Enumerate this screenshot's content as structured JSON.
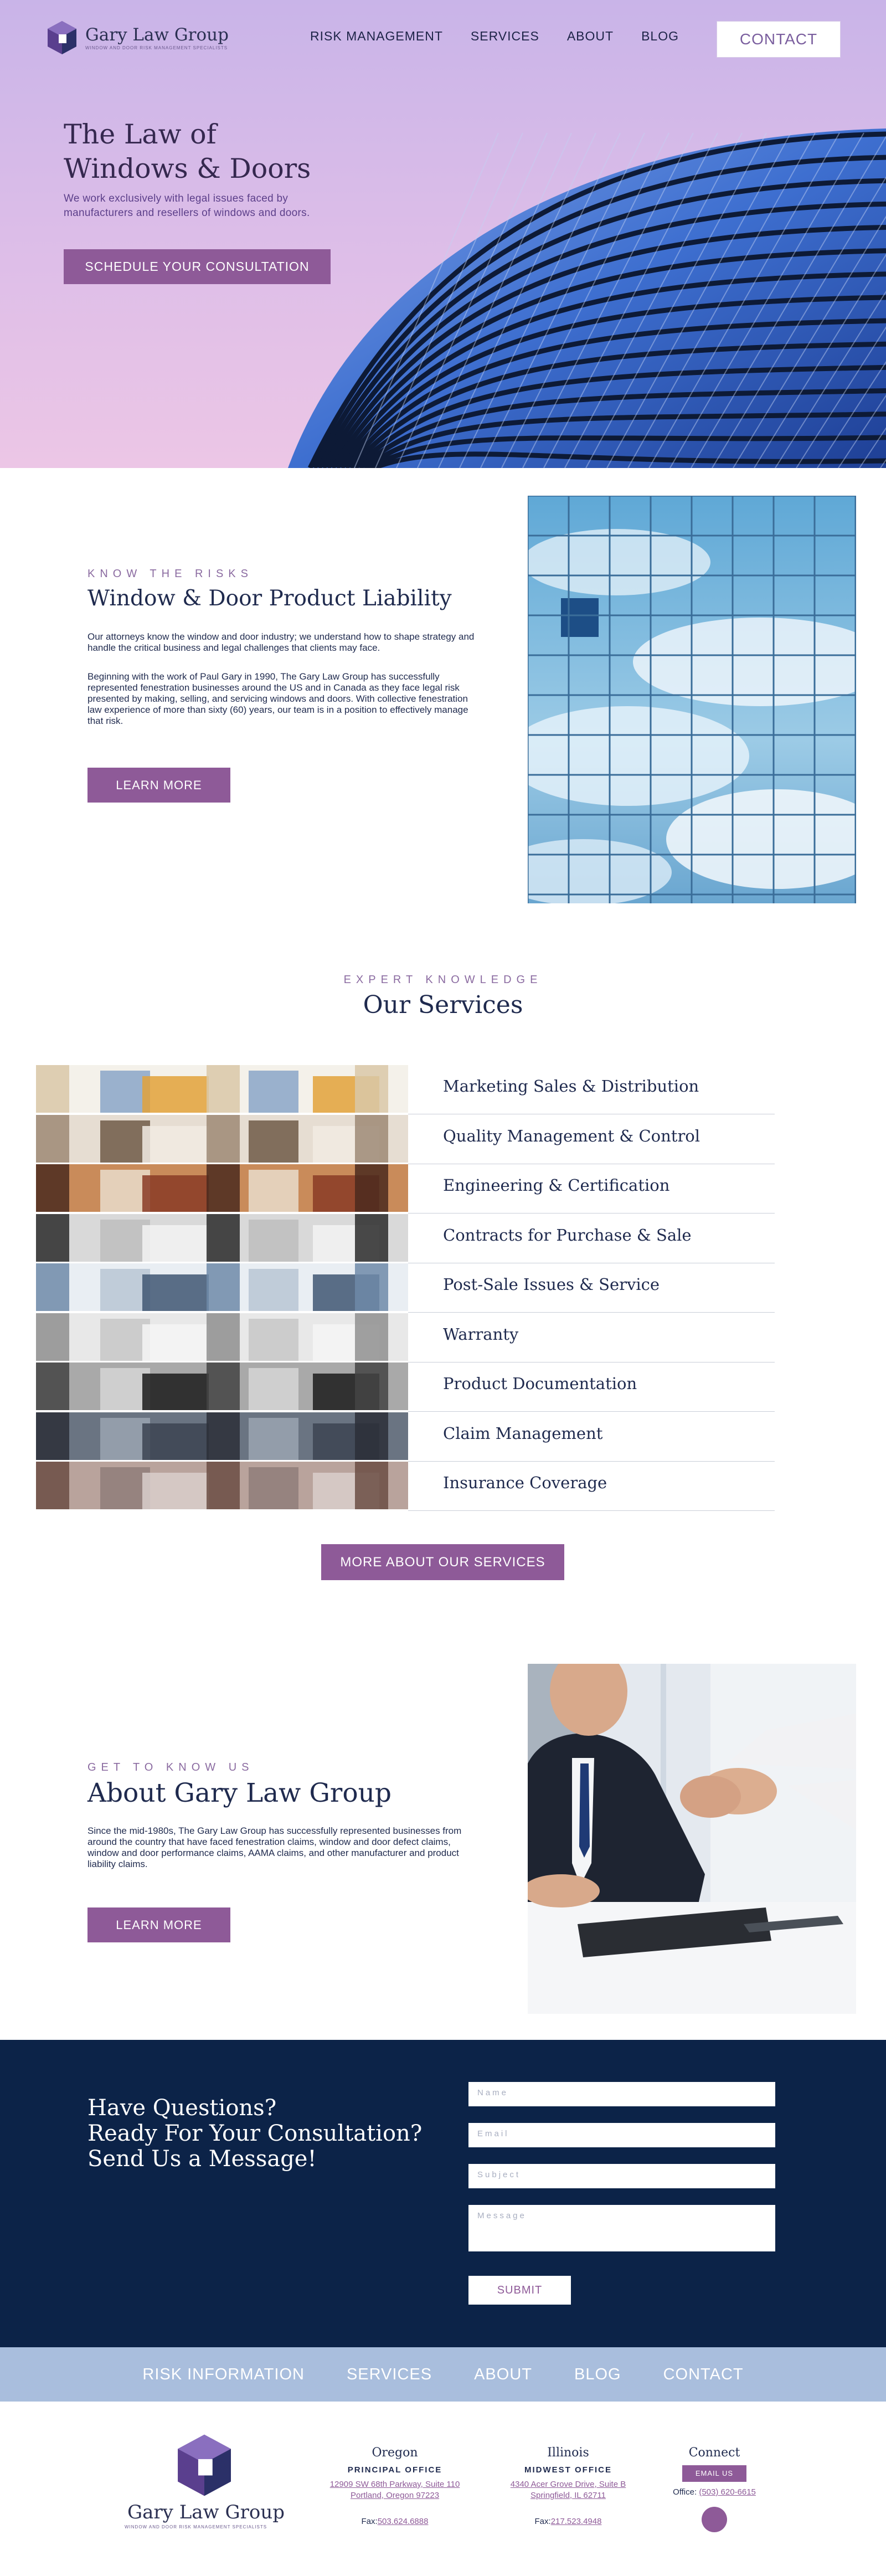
{
  "brand": {
    "name": "Gary Law Group",
    "tagline": "WINDOW AND DOOR RISK MANAGEMENT SPECIALISTS"
  },
  "nav": {
    "items": [
      "RISK MANAGEMENT",
      "SERVICES",
      "ABOUT",
      "BLOG"
    ],
    "contact": "CONTACT"
  },
  "hero": {
    "title_line1": "The Law of",
    "title_line2": "Windows & Doors",
    "subtitle": "We work exclusively with legal issues faced by manufacturers and resellers of windows and doors.",
    "cta": "SCHEDULE YOUR CONSULTATION"
  },
  "risk": {
    "eyebrow": "KNOW THE RISKS",
    "title": "Window & Door Product Liability",
    "para1": "Our attorneys know the window and door industry; we understand how to shape strategy and handle the critical business and legal challenges that clients may face.",
    "para2": "Beginning with the work of Paul Gary in 1990, The Gary Law Group has successfully represented fenestration businesses around the US and in Canada as they face legal risk presented by making, selling, and servicing windows and doors.  With collective fenestration law experience of more than sixty (60) years, our team is in a position to effectively manage that risk.",
    "cta": "LEARN MORE"
  },
  "services": {
    "eyebrow": "EXPERT KNOWLEDGE",
    "title": "Our Services",
    "items": [
      "Marketing Sales & Distribution",
      "Quality Management & Control",
      "Engineering & Certification",
      "Contracts for Purchase & Sale",
      "Post-Sale Issues & Service",
      "Warranty",
      "Product Documentation",
      "Claim Management",
      "Insurance Coverage"
    ],
    "cta": "MORE ABOUT OUR SERVICES"
  },
  "about": {
    "eyebrow": "GET TO KNOW US",
    "title": "About Gary Law Group",
    "para": "Since the mid-1980s, The Gary Law Group has successfully represented businesses from around the country that have faced fenestration claims, window and door defect claims, window and door performance claims, AAMA claims, and other manufacturer and product liability claims.",
    "cta": "LEARN MORE"
  },
  "contact_form": {
    "heading_line1": "Have Questions?",
    "heading_line2": "Ready For Your Consultation?",
    "heading_line3": "Send Us a Message!",
    "name_placeholder": "Name",
    "email_placeholder": "Email",
    "subject_placeholder": "Subject",
    "message_placeholder": "Message",
    "submit": "SUBMIT"
  },
  "footer_nav": [
    "RISK INFORMATION",
    "SERVICES",
    "ABOUT",
    "BLOG",
    "CONTACT"
  ],
  "footer": {
    "oregon": {
      "title": "Oregon",
      "subtitle": "PRINCIPAL OFFICE",
      "address1": "12909 SW 68th Parkway, Suite 110",
      "address2": "Portland, Oregon 97223",
      "fax_label": "Fax:",
      "fax": "503.624.6888"
    },
    "illinois": {
      "title": "Illinois",
      "subtitle": "MIDWEST OFFICE",
      "address1": "4340 Acer Grove Drive, Suite B",
      "address2": "Springfield, IL 62711",
      "fax_label": "Fax:",
      "fax": "217.523.4948"
    },
    "connect": {
      "title": "Connect",
      "email_button": "EMAIL US",
      "office_label": "Office:",
      "office_phone": "(503) 620-6615"
    }
  },
  "colors": {
    "accent": "#8e5a98",
    "navy": "#0c2348",
    "footer_nav": "#a9bedd"
  }
}
